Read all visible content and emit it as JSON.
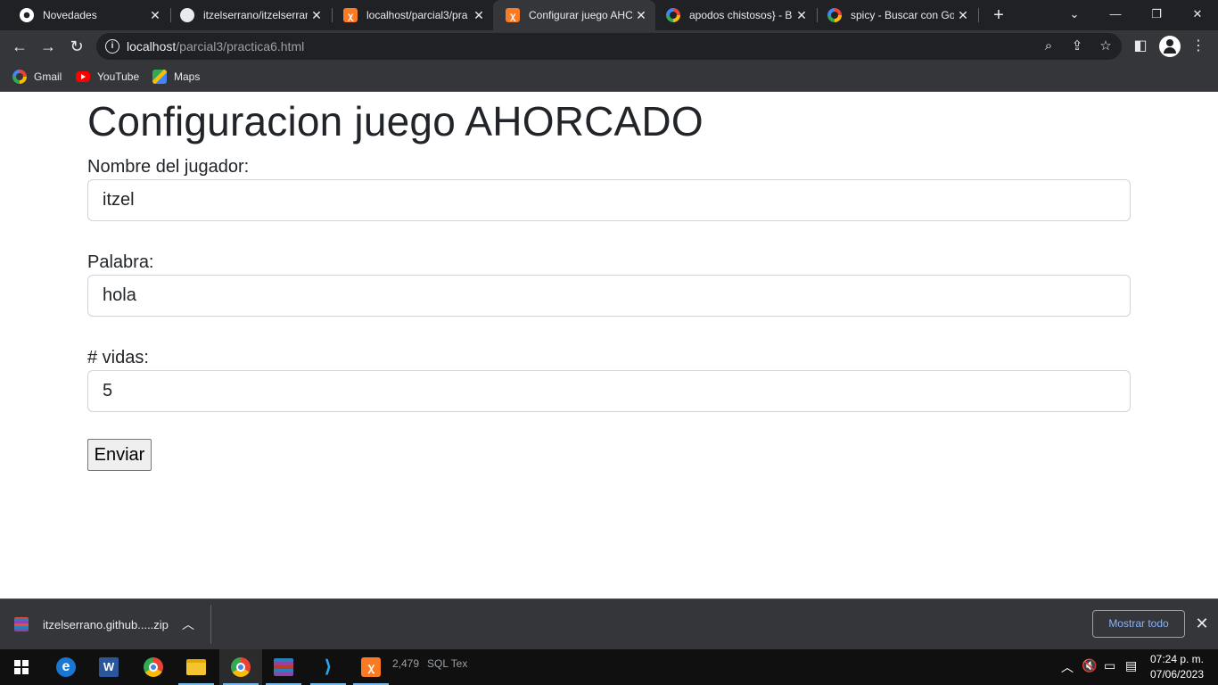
{
  "browser": {
    "tabs": [
      {
        "title": "Novedades",
        "icon": "chrome-icon",
        "active": false
      },
      {
        "title": "itzelserrano/itzelserrar",
        "icon": "github-icon",
        "active": false
      },
      {
        "title": "localhost/parcial3/pra",
        "icon": "xampp-icon",
        "active": false
      },
      {
        "title": "Configurar juego AHC",
        "icon": "xampp-icon",
        "active": true
      },
      {
        "title": "apodos chistosos} - Bu",
        "icon": "google-icon",
        "active": false
      },
      {
        "title": "spicy - Buscar con Goo",
        "icon": "google-icon",
        "active": false
      }
    ],
    "url_host": "localhost",
    "url_path": "/parcial3/practica6.html",
    "bookmarks": [
      {
        "label": "Gmail",
        "icon": "google-icon"
      },
      {
        "label": "YouTube",
        "icon": "youtube-icon"
      },
      {
        "label": "Maps",
        "icon": "maps-icon"
      }
    ]
  },
  "page": {
    "heading": "Configuracion juego AHORCADO",
    "fields": [
      {
        "label": "Nombre del jugador:",
        "value": "itzel"
      },
      {
        "label": "Palabra:",
        "value": "hola"
      },
      {
        "label": "# vidas:",
        "value": "5"
      }
    ],
    "submit_label": "Enviar"
  },
  "downloads": {
    "filename": "itzelserrano.github.....zip",
    "show_all": "Mostrar todo"
  },
  "taskbar": {
    "ghost_text_1": "2,479",
    "ghost_text_2": "SQL Tex",
    "time": "07:24 p. m.",
    "date": "07/06/2023"
  }
}
